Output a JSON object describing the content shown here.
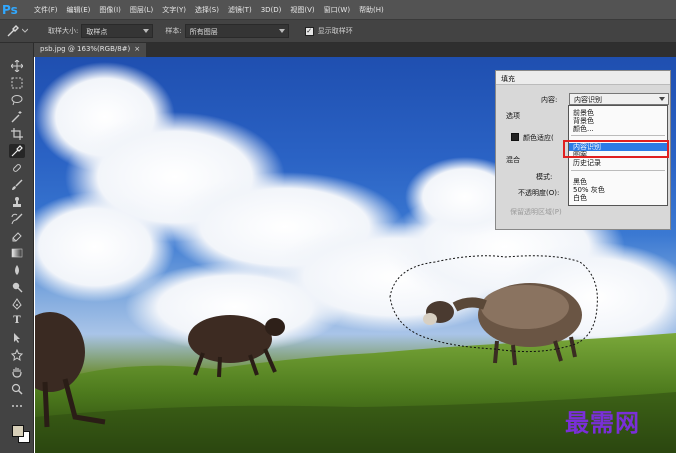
{
  "app": {
    "logo": "Ps"
  },
  "menu": [
    "文件(F)",
    "编辑(E)",
    "图像(I)",
    "图层(L)",
    "文字(Y)",
    "选择(S)",
    "滤镜(T)",
    "3D(D)",
    "视图(V)",
    "窗口(W)",
    "帮助(H)"
  ],
  "options": {
    "sample_size_label": "取样大小:",
    "sample_size_value": "取样点",
    "sample_label": "样本:",
    "sample_value": "所有图层",
    "show_ring_label": "显示取样环",
    "show_ring_checked": true
  },
  "document": {
    "tab_title": "psb.jpg @ 163%(RGB/8#)",
    "close_glyph": "×"
  },
  "fill_dialog": {
    "title": "填充",
    "content_label": "内容:",
    "content_value": "内容识别",
    "options_label": "选项",
    "color_adapt_label": "颜色适应(",
    "blending_label": "混合",
    "mode_label": "模式:",
    "opacity_label": "不透明度(O):",
    "preserve_label": "保留透明区域(P)"
  },
  "content_dropdown": {
    "items": [
      "前景色",
      "背景色",
      "颜色...",
      "内容识别",
      "图案",
      "历史记录",
      "黑色",
      "50% 灰色",
      "白色"
    ],
    "selected_index": 3
  },
  "watermark": {
    "text": "最需网"
  },
  "colors": {
    "accent": "#31a8ff",
    "highlight_box": "#e02020",
    "selection": "#2c7be5",
    "watermark": "#7a2fd8"
  }
}
